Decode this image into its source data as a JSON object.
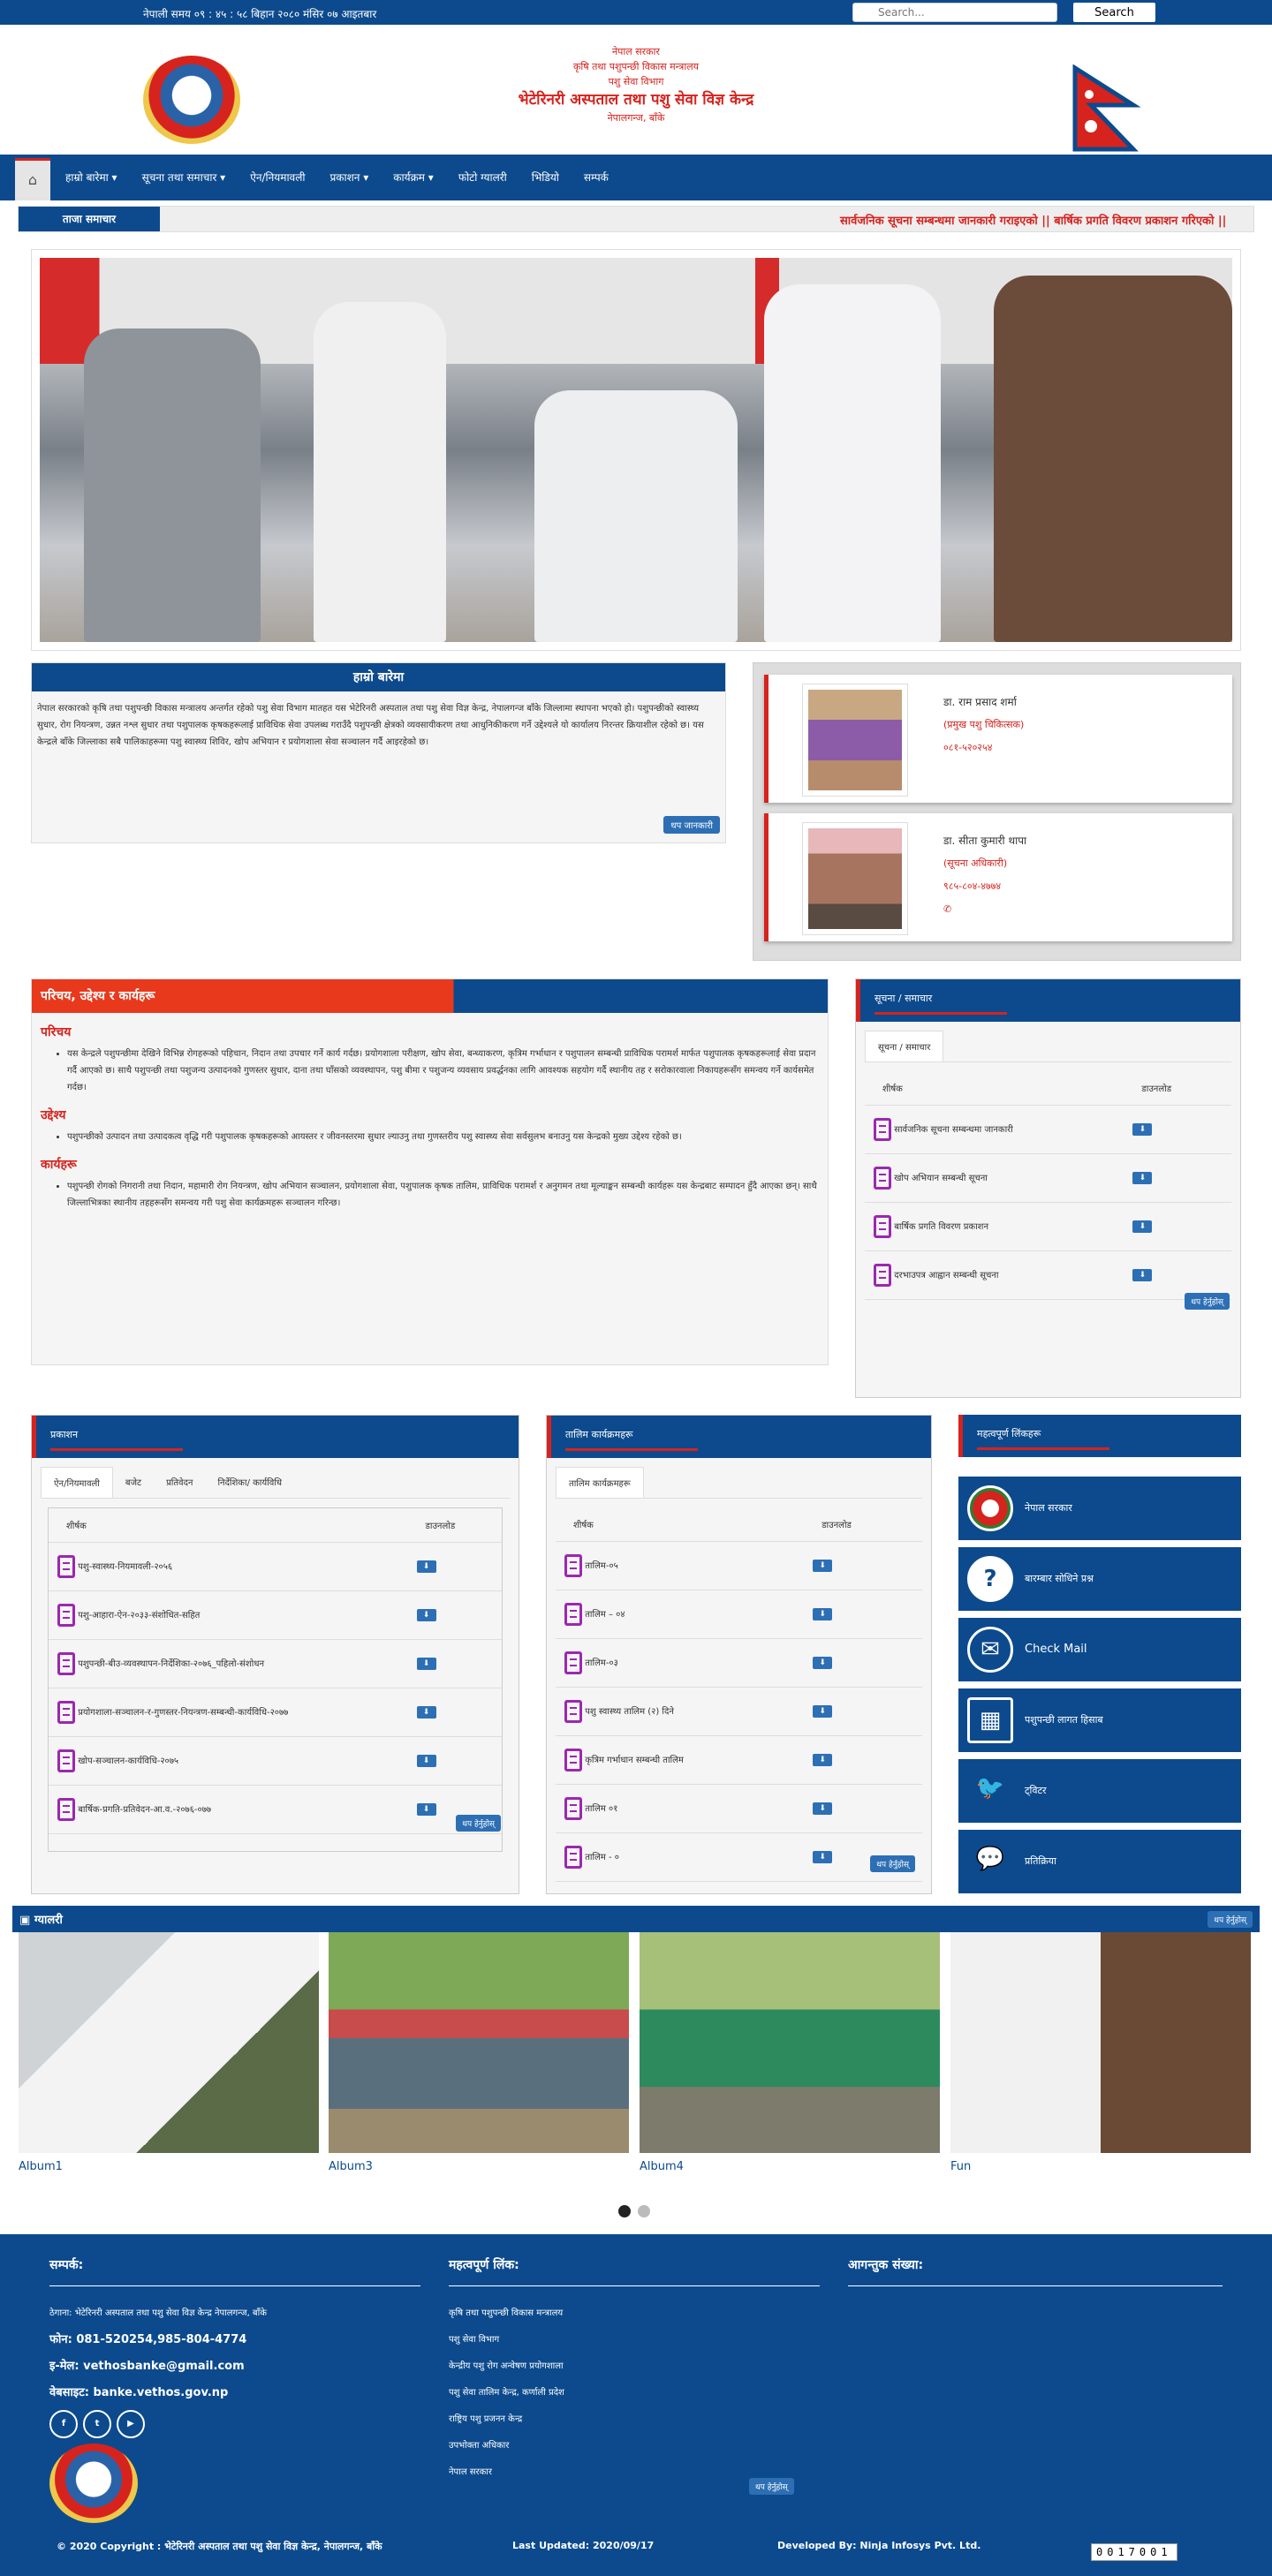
{
  "topbar": {
    "time": "नेपाली समय ०९ : ४५ : ५८ बिहान   २०८० मंसिर ०७ आइतबार",
    "search_placeholder": "Search...",
    "search_button": "Search"
  },
  "header": {
    "line1": "नेपाल सरकार",
    "line2": "कृषि तथा पशुपन्छी विकास मन्त्रालय",
    "line3": "पशु सेवा विभाग",
    "line4": "भेटेरिनरी अस्पताल तथा पशु सेवा विज्ञ केन्द्र",
    "line5": "नेपालगन्ज, बाँके"
  },
  "nav": {
    "home_icon": "home-icon",
    "items": [
      "हाम्रो बारेमा ▾",
      "सूचना तथा समाचार ▾",
      "ऐन/नियमावली",
      "प्रकाशन ▾",
      "कार्यक्रम ▾",
      "फोटो ग्यालरी",
      "भिडियो",
      "सम्पर्क"
    ]
  },
  "news": {
    "label": "ताजा समाचार",
    "ticker": "सार्वजनिक सूचना सम्बन्धमा जानकारी गराइएको ||   बार्षिक प्रगति विवरण प्रकाशन गरिएको ||"
  },
  "about": {
    "title": "हाम्रो बारेमा",
    "text": "नेपाल सरकारको कृषि तथा पशुपन्छी विकास मन्त्रालय अन्तर्गत रहेको पशु सेवा विभाग मातहत यस भेटेरिनरी अस्पताल तथा पशु सेवा विज्ञ केन्द्र, नेपालगन्ज बाँके जिल्लामा स्थापना भएको हो। पशुपन्छीको स्वास्थ्य सुधार, रोग नियन्त्रण, उन्नत नश्ल सुधार तथा पशुपालक कृषकहरूलाई प्राविधिक सेवा उपलब्ध गराउँदै पशुपन्छी क्षेत्रको व्यवसायीकरण तथा आधुनिकीकरण गर्ने उद्देश्यले यो कार्यालय निरन्तर क्रियाशील रहेको छ। यस केन्द्रले बाँके जिल्लाका सबै पालिकाहरूमा पशु स्वास्थ्य शिविर, खोप अभियान र प्रयोगशाला सेवा सञ्चालन गर्दै आइरहेको छ।",
    "more": "थप जानकारी"
  },
  "officials": [
    {
      "name": "डा. राम प्रसाद शर्मा",
      "role": "(प्रमुख पशु चिकित्सक)",
      "phone": "०८१-५२०२५४"
    },
    {
      "name": "डा. सीता कुमारी थापा",
      "role": "(सूचना अधिकारी)",
      "phone": "९८५-८०४-४७७४"
    }
  ],
  "intro": {
    "title": "परिचय, उद्देश्य र कार्यहरू",
    "h1": "परिचय",
    "p1": "यस केन्द्रले पशुपन्छीमा देखिने विभिन्न रोगहरूको पहिचान, निदान तथा उपचार गर्ने कार्य गर्दछ। प्रयोगशाला परीक्षण, खोप सेवा, बन्ध्याकरण, कृत्रिम गर्भाधान र पशुपालन सम्बन्धी प्राविधिक परामर्श मार्फत पशुपालक कृषकहरूलाई सेवा प्रदान गर्दै आएको छ। साथै पशुपन्छी तथा पशुजन्य उत्पादनको गुणस्तर सुधार, दाना तथा घाँसको व्यवस्थापन, पशु बीमा र पशुजन्य व्यवसाय प्रवर्द्धनका लागि आवश्यक सहयोग गर्दै स्थानीय तह र सरोकारवाला निकायहरूसँग समन्वय गर्ने कार्यसमेत गर्दछ।",
    "h2": "उद्देश्य",
    "p2": "पशुपन्छीको उत्पादन तथा उत्पादकत्व वृद्धि गरी पशुपालक कृषकहरूको आयस्तर र जीवनस्तरमा सुधार ल्याउनु तथा गुणस्तरीय पशु स्वास्थ्य सेवा सर्वसुलभ बनाउनु यस केन्द्रको मुख्य उद्देश्य रहेको छ।",
    "h3": "कार्यहरू",
    "p3": "पशुपन्छी रोगको निगरानी तथा निदान, महामारी रोग नियन्त्रण, खोप अभियान सञ्चालन, प्रयोगशाला सेवा, पशुपालक कृषक तालिम, प्राविधिक परामर्श र अनुगमन तथा मूल्याङ्कन सम्बन्धी कार्यहरू यस केन्द्रबाट सम्पादन हुँदै आएका छन्। साथै जिल्लाभित्रका स्थानीय तहहरूसँग समन्वय गरी पशु सेवा कार्यक्रमहरू सञ्चालन गरिन्छ।"
  },
  "notices": {
    "title": "सूचना / समाचार",
    "tab": "सूचना / समाचार",
    "col1": "शीर्षक",
    "col2": "डाउनलोड",
    "rows": [
      "सार्वजनिक सूचना सम्बन्धमा जानकारी",
      "खोप अभियान सम्बन्धी सूचना",
      "बार्षिक प्रगति विवरण प्रकाशन",
      "दरभाउपत्र आह्वान सम्बन्धी सूचना"
    ],
    "more": "थप हेर्नुहोस्"
  },
  "publications": {
    "title": "प्रकाशन",
    "tabs": [
      "ऐन/नियमावली",
      "बजेट",
      "प्रतिवेदन",
      "निर्देशिका/ कार्यविधि"
    ],
    "col1": "शीर्षक",
    "col2": "डाउनलोड",
    "rows": [
      "पशु-स्वास्थ्य-नियमावली-२०५६",
      "पशु-आहारा-ऐन-२०३३-संशोधित-सहित",
      "पशुपन्छी-बीउ-व्यवस्थापन-निर्देशिका-२०७६_पहिलो-संशोधन",
      "प्रयोगशाला-सञ्चालन-र-गुणस्तर-नियन्त्रण-सम्बन्धी-कार्यविधि-२०७७",
      "खोप-सञ्चालन-कार्यविधि-२०७५",
      "बार्षिक-प्रगति-प्रतिवेदन-आ.व.-२०७६-०७७"
    ],
    "more": "थप हेर्नुहोस्"
  },
  "training": {
    "title": "तालिम कार्यक्रमहरू",
    "tab": "तालिम कार्यक्रमहरू",
    "col1": "शीर्षक",
    "col2": "डाउनलोड",
    "rows": [
      "तालिम-०५",
      "तालिम – ०४",
      "तालिम-०३",
      "पशु स्वास्थ्य तालिम (२) दिने",
      "कृत्रिम गर्भाधान सम्बन्धी तालिम",
      "तालिम ०१",
      "तालिम - ०"
    ],
    "more": "थप हेर्नुहोस्"
  },
  "links": {
    "title": "महत्वपूर्ण लिंकहरू",
    "items": [
      {
        "icon": "emblem-icon",
        "label": "नेपाल सरकार"
      },
      {
        "icon": "question-icon",
        "label": "बारम्बार सोधिने प्रश्न"
      },
      {
        "icon": "mail-icon",
        "label": "Check Mail"
      },
      {
        "icon": "calculator-icon",
        "label": "पशुपन्छी लागत हिसाब"
      },
      {
        "icon": "twitter-icon",
        "label": "ट्विटर"
      },
      {
        "icon": "comment-icon",
        "label": "प्रतिक्रिया"
      }
    ]
  },
  "gallery": {
    "title": "ग्यालरी",
    "more": "थप हेर्नुहोस्",
    "albums": [
      "Album1",
      "Album3",
      "Album4",
      "Fun"
    ]
  },
  "footer": {
    "contact_title": "सम्पर्क:",
    "address": "ठेगाना: भेटेरिनरी अस्पताल तथा पशु सेवा विज्ञ केन्द्र नेपालगन्ज, बाँके",
    "phone": "फोन: 081-520254,985-804-4774",
    "email": "इ-मेल: vethosbanke@gmail.com",
    "website": "वेबसाइट: banke.vethos.gov.np",
    "links_title": "महत्वपूर्ण लिंक:",
    "links": [
      "कृषि तथा पशुपन्छी विकास मन्त्रालय",
      "पशु सेवा विभाग",
      "केन्द्रीय पशु रोग अन्वेषण प्रयोगशाला",
      "पशु सेवा तालिम केन्द्र, कर्णाली प्रदेश",
      "राष्ट्रिय पशु प्रजनन केन्द्र",
      "उपभोक्ता अधिकार",
      "नेपाल सरकार"
    ],
    "links_more": "थप हेर्नुहोस्",
    "visitor_title": "आगन्तुक संख्या:",
    "copyright": "© 2020 Copyright : भेटेरिनरी अस्पताल तथा पशु सेवा विज्ञ केन्द्र, नेपालगन्ज, बाँके",
    "updated": "Last Updated: 2020/09/17",
    "developer": "Developed By: Ninja Infosys Pvt. Ltd.",
    "counter": "0017001"
  }
}
